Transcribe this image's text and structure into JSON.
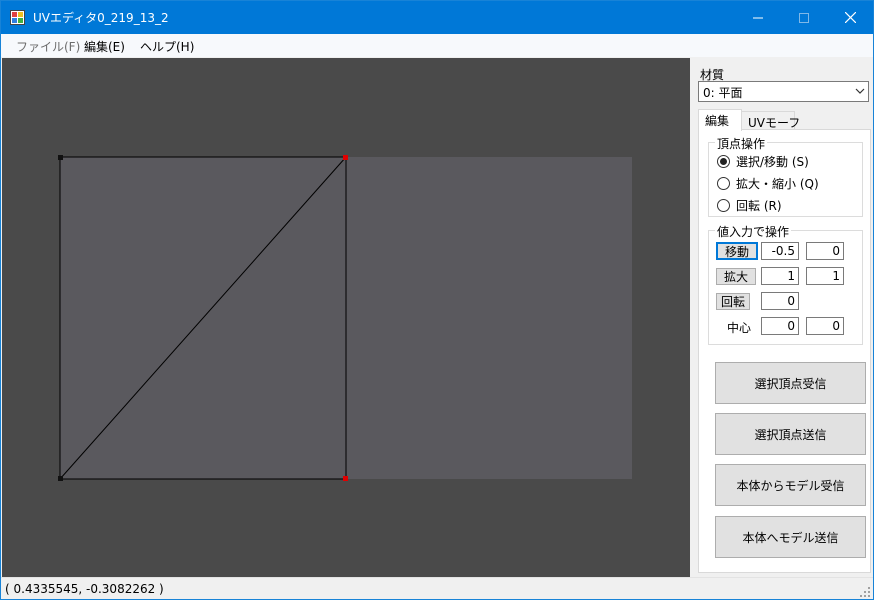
{
  "window": {
    "title": "UVエディタ0_219_13_2"
  },
  "icons": {
    "app": "app-icon",
    "minimize": "minimize-icon",
    "maximize": "maximize-icon",
    "close": "close-icon",
    "dropdown": "chevron-down-icon",
    "grip": "resize-grip-icon"
  },
  "menu": {
    "file": "ファイル(F)",
    "edit": "編集(E)",
    "help": "ヘルプ(H)"
  },
  "panel": {
    "material_label": "材質",
    "material_selected": "0: 平面",
    "tabs": {
      "edit": "編集",
      "uv_morph": "UVモーフ"
    },
    "vertex_group": {
      "title": "頂点操作",
      "select_move": "選択/移動 (S)",
      "scale": "拡大・縮小 (Q)",
      "rotate": "回転 (R)",
      "selected": "select_move"
    },
    "value_group": {
      "title": "値入力で操作",
      "move_label": "移動",
      "move_x": "-0.5",
      "move_y": "0",
      "scale_label": "拡大",
      "scale_x": "1",
      "scale_y": "1",
      "rotate_label": "回転",
      "rotate_value": "0",
      "center_label": "中心",
      "center_x": "0",
      "center_y": "0"
    },
    "buttons": {
      "receive_selected": "選択頂点受信",
      "send_selected": "選択頂点送信",
      "receive_model": "本体からモデル受信",
      "send_model": "本体へモデル送信"
    }
  },
  "colors": {
    "titlebar": "#0078d7",
    "canvas": "#4a4a4a",
    "texture": "#5a595e",
    "selected_vertex": "#e00000",
    "vertex": "#111111"
  },
  "status": {
    "coords": "( 0.4335545, -0.3082262 )"
  }
}
